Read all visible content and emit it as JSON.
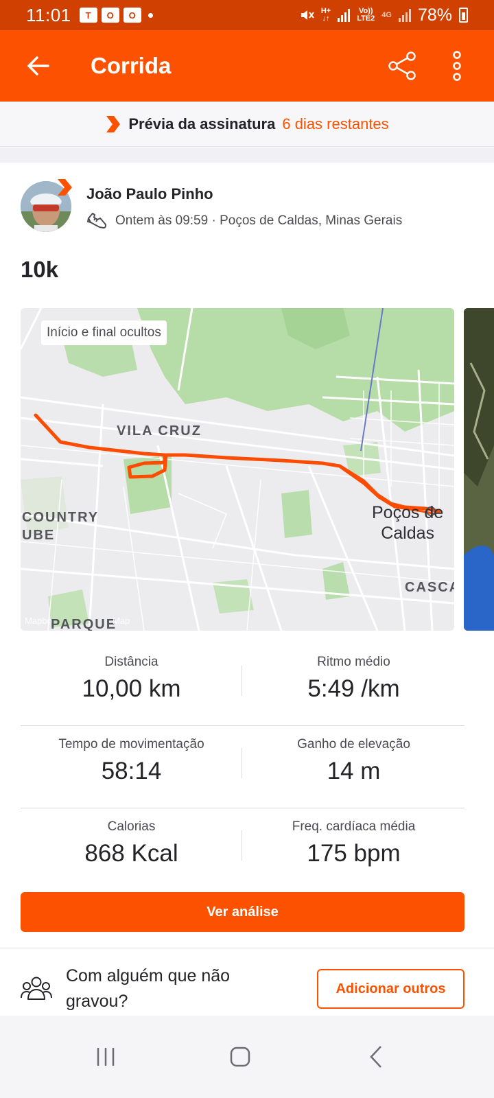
{
  "status_bar": {
    "time": "11:01",
    "network_top": "H+",
    "volte_top": "Vo))",
    "volte_bottom": "LTE2",
    "network_4g": "4G",
    "battery": "78%"
  },
  "app_bar": {
    "title": "Corrida"
  },
  "subscription": {
    "title": "Prévia da assinatura",
    "days_left": "6 dias restantes"
  },
  "athlete": {
    "name": "João Paulo Pinho",
    "meta": "Ontem às 09:59 · Poços de Caldas, Minas Gerais"
  },
  "activity": {
    "title": "10k"
  },
  "map": {
    "chip": "Início e final ocultos",
    "labels": {
      "vila_cruz": "VILA CRUZ",
      "country": "COUNTRY",
      "clube": "UBE",
      "parque": "PARQUE",
      "casca": "CASCA",
      "city_line1": "Poços de",
      "city_line2": "Caldas",
      "attribution": "Mapbo",
      "attribution2": "Map"
    },
    "route_color": "#fc4c02"
  },
  "stats": [
    {
      "label": "Distância",
      "value": "10,00 km"
    },
    {
      "label": "Ritmo médio",
      "value": "5:49 /km"
    },
    {
      "label": "Tempo de movimentação",
      "value": "58:14"
    },
    {
      "label": "Ganho de elevação",
      "value": "14 m"
    },
    {
      "label": "Calorias",
      "value": "868 Kcal"
    },
    {
      "label": "Freq. cardíaca média",
      "value": "175 bpm"
    }
  ],
  "actions": {
    "analysis": "Ver análise",
    "together_text": "Com alguém que não gravou?",
    "add_others": "Adicionar outros"
  },
  "colors": {
    "brand": "#fc5200",
    "status_bar": "#d04000"
  },
  "icons": [
    "back-arrow-icon",
    "share-icon",
    "more-vert-icon",
    "strava-chevron-icon",
    "shoe-icon",
    "people-icon"
  ]
}
